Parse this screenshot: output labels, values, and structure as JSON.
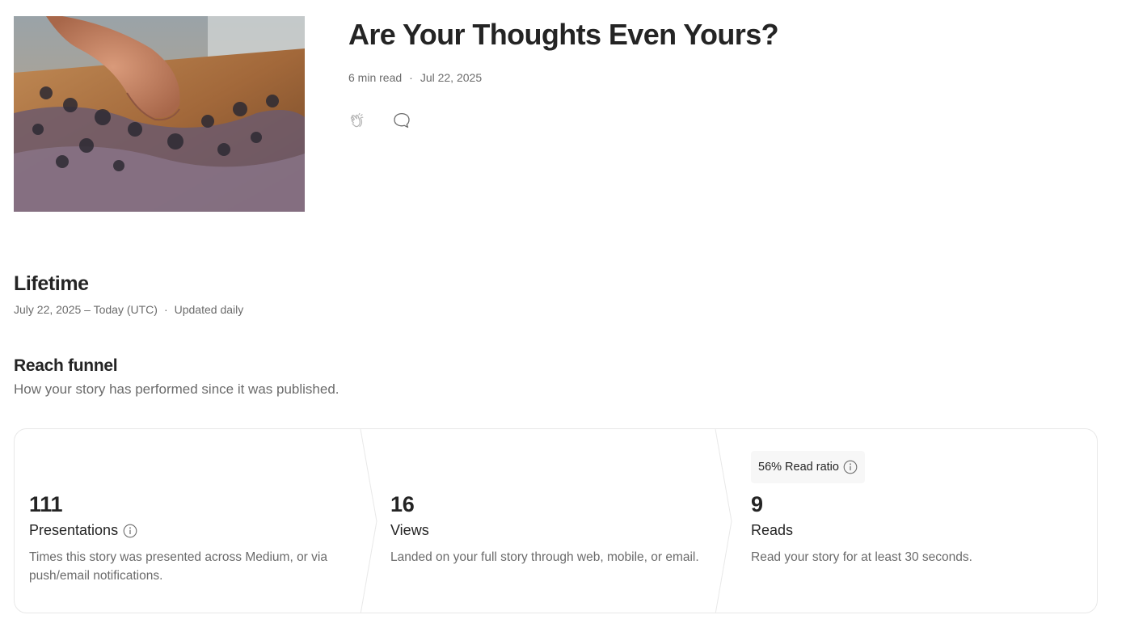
{
  "story": {
    "title": "Are Your Thoughts Even Yours?",
    "read_time": "6 min read",
    "date": "Jul 22, 2025",
    "meta_separator": "·",
    "actions": [
      {
        "icon": "clap-icon"
      },
      {
        "icon": "comment-icon"
      }
    ]
  },
  "lifetime": {
    "title": "Lifetime",
    "range": "July 22, 2025 – Today (UTC)",
    "separator": "·",
    "update_note": "Updated daily"
  },
  "reach_funnel": {
    "title": "Reach funnel",
    "subtitle": "How your story has performed since it was published.",
    "read_ratio_badge": "56% Read ratio",
    "stages": [
      {
        "value": "111",
        "label": "Presentations",
        "description": "Times this story was presented across Medium, or via push/email notifications.",
        "has_info": true
      },
      {
        "value": "16",
        "label": "Views",
        "description": "Landed on your full story through web, mobile, or email.",
        "has_info": false
      },
      {
        "value": "9",
        "label": "Reads",
        "description": "Read your story for at least 30 seconds.",
        "has_info": false
      }
    ]
  },
  "colors": {
    "text_primary": "#242424",
    "text_secondary": "#6b6b6b",
    "border": "#e8e8e8",
    "badge_bg": "#f7f7f7"
  }
}
